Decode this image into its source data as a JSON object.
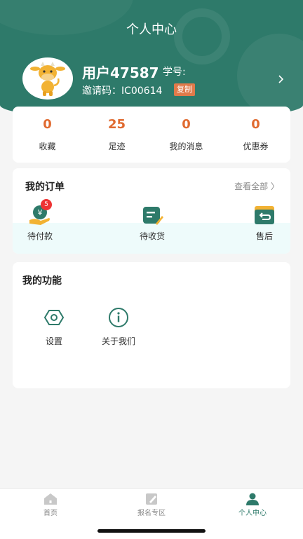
{
  "header": {
    "title": "个人中心",
    "username": "用户47587",
    "student_no_label": "学号:",
    "invite_code": "邀请码：IC00614",
    "copy_label": "复制"
  },
  "stats": [
    {
      "value": "0",
      "label": "收藏"
    },
    {
      "value": "25",
      "label": "足迹"
    },
    {
      "value": "0",
      "label": "我的消息"
    },
    {
      "value": "0",
      "label": "优惠券"
    }
  ],
  "orders": {
    "title": "我的订单",
    "view_all": "查看全部 〉",
    "items": [
      {
        "label": "待付款",
        "badge": "5",
        "icon": "payment-icon"
      },
      {
        "label": "待收货",
        "icon": "receive-icon"
      },
      {
        "label": "售后",
        "icon": "after-sales-icon"
      }
    ]
  },
  "functions": {
    "title": "我的功能",
    "items": [
      {
        "label": "设置",
        "icon": "settings-icon"
      },
      {
        "label": "关于我们",
        "icon": "info-icon"
      }
    ]
  },
  "tabbar": {
    "items": [
      {
        "label": "首页",
        "icon": "home-icon",
        "active": false
      },
      {
        "label": "报名专区",
        "icon": "edit-icon",
        "active": false
      },
      {
        "label": "个人中心",
        "icon": "user-icon",
        "active": true
      }
    ]
  },
  "colors": {
    "brand": "#2e7a6a",
    "accent": "#e06a30",
    "badge": "#e33333"
  }
}
